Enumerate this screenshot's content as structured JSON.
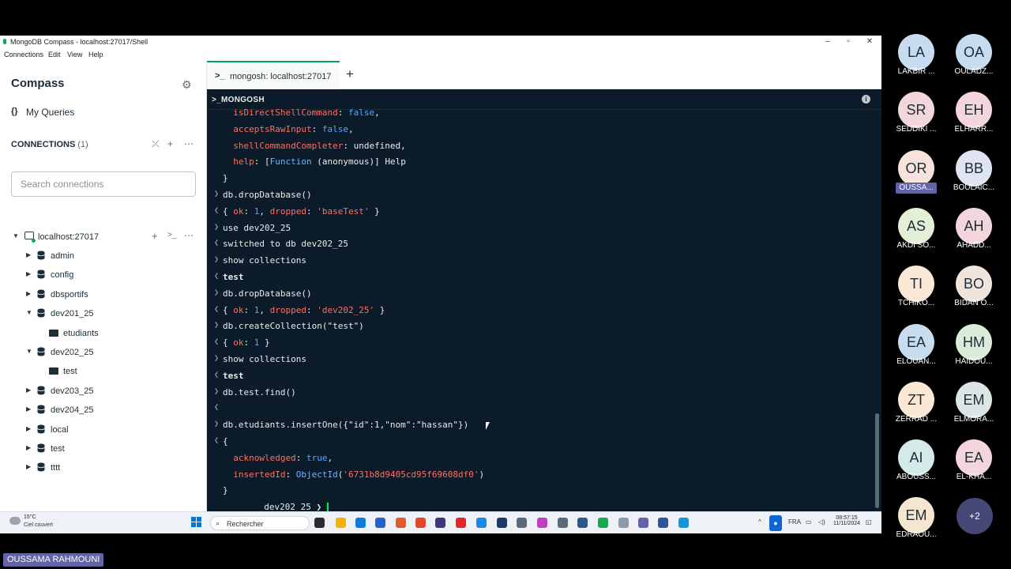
{
  "window": {
    "title": "MongoDB Compass - localhost:27017/Shell",
    "controls": {
      "minimize": "–",
      "maximize": "▫",
      "close": "✕"
    }
  },
  "menu": [
    "Connections",
    "Edit",
    "View",
    "Help"
  ],
  "sidebar": {
    "app_title": "Compass",
    "my_queries": "My Queries",
    "my_queries_icon": "{}",
    "connections_label": "CONNECTIONS",
    "connections_count": "(1)",
    "search_placeholder": "Search connections",
    "host": "localhost:27017",
    "tree": [
      {
        "label": "admin",
        "type": "db",
        "expanded": false
      },
      {
        "label": "config",
        "type": "db",
        "expanded": false
      },
      {
        "label": "dbsportifs",
        "type": "db",
        "expanded": false
      },
      {
        "label": "dev201_25",
        "type": "db",
        "expanded": true
      },
      {
        "label": "etudiants",
        "type": "collection"
      },
      {
        "label": "dev202_25",
        "type": "db",
        "expanded": true
      },
      {
        "label": "test",
        "type": "collection"
      },
      {
        "label": "dev203_25",
        "type": "db",
        "expanded": false
      },
      {
        "label": "dev204_25",
        "type": "db",
        "expanded": false
      },
      {
        "label": "local",
        "type": "db",
        "expanded": false
      },
      {
        "label": "test",
        "type": "db",
        "expanded": false
      },
      {
        "label": "tttt",
        "type": "db",
        "expanded": false
      }
    ]
  },
  "tabs": {
    "active_tab": "mongosh: localhost:27017",
    "tab_icon": ">_",
    "add": "+"
  },
  "shell": {
    "header": ">_MONGOSH",
    "info_icon": "i",
    "prompt": "dev202_25",
    "lines": [
      {
        "p": "",
        "segs": [
          [
            "k",
            "  isDirectShellCommand"
          ],
          [
            "u",
            ": "
          ],
          [
            "n",
            "false"
          ],
          [
            "u",
            ","
          ]
        ]
      },
      {
        "p": "",
        "segs": [
          [
            "k",
            "  acceptsRawInput"
          ],
          [
            "u",
            ": "
          ],
          [
            "n",
            "false"
          ],
          [
            "u",
            ","
          ]
        ]
      },
      {
        "p": "",
        "segs": [
          [
            "k",
            "  shellCommandCompleter"
          ],
          [
            "u",
            ": undefined,"
          ]
        ]
      },
      {
        "p": "",
        "segs": [
          [
            "k",
            "  help"
          ],
          [
            "u",
            ": ["
          ],
          [
            "b",
            "Function"
          ],
          [
            "u",
            " (anonymous)] Help"
          ]
        ]
      },
      {
        "p": "",
        "segs": [
          [
            "u",
            "}"
          ]
        ]
      },
      {
        "p": ">",
        "segs": [
          [
            "u",
            "db.dropDatabase()"
          ]
        ]
      },
      {
        "p": "<",
        "segs": [
          [
            "u",
            "{ "
          ],
          [
            "k",
            "ok"
          ],
          [
            "u",
            ": "
          ],
          [
            "n",
            "1"
          ],
          [
            "u",
            ", "
          ],
          [
            "k",
            "dropped"
          ],
          [
            "u",
            ": "
          ],
          [
            "s",
            "'baseTest'"
          ],
          [
            "u",
            " }"
          ]
        ]
      },
      {
        "p": ">",
        "segs": [
          [
            "u",
            "use dev202_25"
          ]
        ]
      },
      {
        "p": "<",
        "segs": [
          [
            "u",
            "switched to db dev202_25"
          ]
        ]
      },
      {
        "p": ">",
        "segs": [
          [
            "u",
            "show collections"
          ]
        ]
      },
      {
        "p": "<",
        "segs": [
          [
            "bold",
            "test"
          ]
        ]
      },
      {
        "p": ">",
        "segs": [
          [
            "u",
            "db.dropDatabase()"
          ]
        ]
      },
      {
        "p": "<",
        "segs": [
          [
            "u",
            "{ "
          ],
          [
            "k",
            "ok"
          ],
          [
            "u",
            ": "
          ],
          [
            "n",
            "1"
          ],
          [
            "u",
            ", "
          ],
          [
            "k",
            "dropped"
          ],
          [
            "u",
            ": "
          ],
          [
            "s",
            "'dev202_25'"
          ],
          [
            "u",
            " }"
          ]
        ]
      },
      {
        "p": ">",
        "segs": [
          [
            "u",
            "db.createCollection(\"test\")"
          ]
        ]
      },
      {
        "p": "<",
        "segs": [
          [
            "u",
            "{ "
          ],
          [
            "k",
            "ok"
          ],
          [
            "u",
            ": "
          ],
          [
            "n",
            "1"
          ],
          [
            "u",
            " }"
          ]
        ]
      },
      {
        "p": ">",
        "segs": [
          [
            "u",
            "show collections"
          ]
        ]
      },
      {
        "p": "<",
        "segs": [
          [
            "bold",
            "test"
          ]
        ]
      },
      {
        "p": ">",
        "segs": [
          [
            "u",
            "db.test.find()"
          ]
        ]
      },
      {
        "p": "<",
        "segs": []
      },
      {
        "p": ">",
        "segs": [
          [
            "u",
            "db.etudiants.insertOne({\"id\":1,\"nom\":\"hassan\"})"
          ]
        ]
      },
      {
        "p": "<",
        "segs": [
          [
            "u",
            "{"
          ]
        ]
      },
      {
        "p": "",
        "segs": [
          [
            "k",
            "  acknowledged"
          ],
          [
            "u",
            ": "
          ],
          [
            "n",
            "true"
          ],
          [
            "u",
            ","
          ]
        ]
      },
      {
        "p": "",
        "segs": [
          [
            "k",
            "  insertedId"
          ],
          [
            "u",
            ": "
          ],
          [
            "b",
            "ObjectId"
          ],
          [
            "u",
            "("
          ],
          [
            "s",
            "'6731b8d9405cd95f69608df0'"
          ],
          [
            "u",
            ")"
          ]
        ]
      },
      {
        "p": "",
        "segs": [
          [
            "u",
            "}"
          ]
        ]
      }
    ]
  },
  "taskbar": {
    "temperature": "15°C",
    "weather": "Ciel couvert",
    "search_label": "Rechercher",
    "lang": "FRA",
    "time": "08:57:15",
    "date": "11/11/2024"
  },
  "participants": [
    {
      "initials": "LA",
      "name": "LAKBIR ...",
      "color": "#c7dcef"
    },
    {
      "initials": "OA",
      "name": "OULADZ...",
      "color": "#c7dcef"
    },
    {
      "initials": "SR",
      "name": "SEDDIKI ...",
      "color": "#f3d6db"
    },
    {
      "initials": "EH",
      "name": "ELHARR...",
      "color": "#f3d6db"
    },
    {
      "initials": "OR",
      "name": "OUSSA...",
      "color": "#f7e3dc",
      "highlight": true
    },
    {
      "initials": "BB",
      "name": "BOULAIC...",
      "color": "#dfe3f2"
    },
    {
      "initials": "AS",
      "name": "AKDI SO...",
      "color": "#e3efd6"
    },
    {
      "initials": "AH",
      "name": "AHADD...",
      "color": "#f3d6db"
    },
    {
      "initials": "TI",
      "name": "TCHIKO...",
      "color": "#fbe8d4"
    },
    {
      "initials": "BO",
      "name": "BIDAN O...",
      "color": "#f1e4da"
    },
    {
      "initials": "EA",
      "name": "ELOUAN...",
      "color": "#c7dcef"
    },
    {
      "initials": "HM",
      "name": "HAIDOU...",
      "color": "#d9ecd9"
    },
    {
      "initials": "ZT",
      "name": "ZERRAD ...",
      "color": "#fbe8d4"
    },
    {
      "initials": "EM",
      "name": "ELMORA...",
      "color": "#dce5e6"
    },
    {
      "initials": "AI",
      "name": "ABOUSS...",
      "color": "#d3eae9"
    },
    {
      "initials": "EA",
      "name": "EL-KHA...",
      "color": "#f3d6db"
    },
    {
      "initials": "EM",
      "name": "EDRAOU...",
      "color": "#f4e6cf"
    }
  ],
  "more_participants": "+2",
  "presenter": "OUSSAMA RAHMOUNI"
}
